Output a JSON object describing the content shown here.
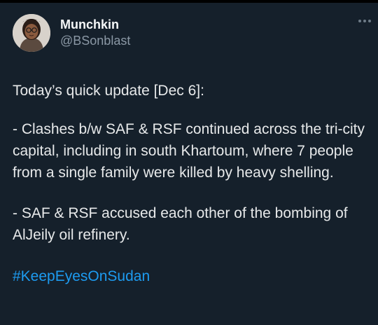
{
  "author": {
    "display_name": "Munchkin",
    "handle": "@BSonblast"
  },
  "tweet": {
    "intro": "Today’s quick update [Dec 6]:",
    "bullet_1": "- Clashes b/w SAF & RSF continued across the tri-city capital, including in south Khartoum, where 7 people from a single family were killed by heavy shelling.",
    "bullet_2": "- SAF & RSF accused each other of the bombing of AlJeily oil refinery.",
    "hashtag": "#KeepEyesOnSudan"
  },
  "icons": {
    "more": "more-dots-icon"
  },
  "colors": {
    "background": "#15202b",
    "text": "#e7e9ea",
    "secondary_text": "#8b98a5",
    "link": "#1d9bf0"
  }
}
